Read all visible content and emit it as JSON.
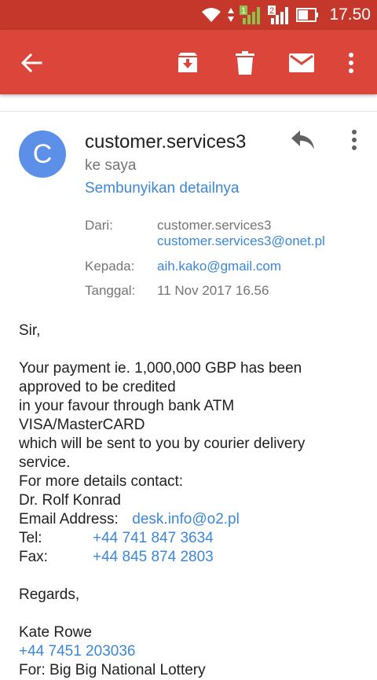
{
  "status": {
    "time": "17.50",
    "sim1": "1",
    "sim2": "2"
  },
  "message": {
    "avatar_letter": "C",
    "sender": "customer.services3",
    "to_me": "ke saya",
    "hide_details": "Sembunyikan detailnya",
    "from_label": "Dari:",
    "from_name": "customer.services3",
    "from_email": "customer.services3@onet.pl",
    "to_label": "Kepada:",
    "to_email": "aih.kako@gmail.com",
    "date_label": "Tanggal:",
    "date": "11 Nov 2017 16.56"
  },
  "body": {
    "greeting": "Sir,",
    "line1": "Your payment ie. 1,000,000 GBP has been",
    "line2": "approved to be credited",
    "line3": "in your favour through bank ATM",
    "line4": "VISA/MasterCARD",
    "line5": "which will be sent to you by courier delivery",
    "line6": "service.",
    "line7": "For more details contact:",
    "contact_name": "Dr. Rolf Konrad",
    "email_label": "Email Address:",
    "email": "desk.info@o2.pl",
    "tel_label": "Tel:",
    "tel": "+44 741 847 3634",
    "fax_label": "Fax:",
    "fax": "+44 845 874 2803",
    "regards": "Regards,",
    "signer": "Kate Rowe",
    "signer_phone": "+44 7451 203036",
    "for_line": "For: Big Big National Lottery"
  },
  "colors": {
    "statusbar": "#c5372a",
    "appbar": "#dc4539",
    "avatar": "#5b8fe8",
    "link": "#3b87d8"
  },
  "icons": [
    "wifi-icon",
    "signal-icon",
    "battery-icon",
    "back-arrow-icon",
    "archive-icon",
    "delete-icon",
    "mail-icon",
    "more-vert-icon",
    "reply-icon"
  ]
}
